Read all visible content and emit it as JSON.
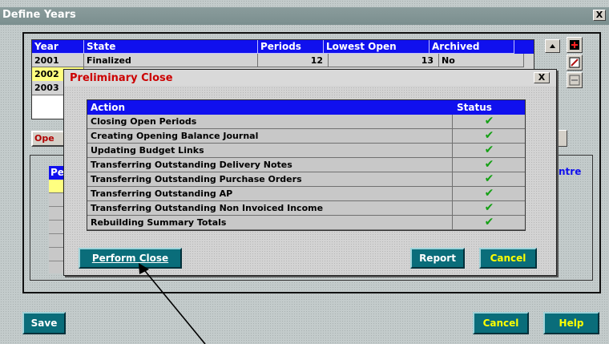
{
  "window": {
    "title": "Define Years",
    "close_glyph": "X"
  },
  "years_table": {
    "columns": [
      "Year",
      "State",
      "Periods",
      "Lowest Open",
      "Archived"
    ],
    "rows": [
      {
        "year": "2001",
        "state": "Finalized",
        "periods": "12",
        "lowest_open": "13",
        "archived": "No"
      },
      {
        "year": "2002"
      },
      {
        "year": "2003"
      }
    ]
  },
  "partial": {
    "open_button": "Ope",
    "period_header": "Pe",
    "centre_label": "ntre"
  },
  "dialog": {
    "title": "Preliminary Close",
    "close_glyph": "X",
    "columns": {
      "action": "Action",
      "status": "Status"
    },
    "rows": [
      {
        "action": "Closing Open Periods",
        "status": "done"
      },
      {
        "action": "Creating Opening Balance Journal",
        "status": "done"
      },
      {
        "action": "Updating Budget Links",
        "status": "done"
      },
      {
        "action": "Transferring Outstanding Delivery Notes",
        "status": "done"
      },
      {
        "action": "Transferring Outstanding Purchase Orders",
        "status": "done"
      },
      {
        "action": "Transferring Outstanding AP",
        "status": "done"
      },
      {
        "action": "Transferring Outstanding Non Invoiced Income",
        "status": "done"
      },
      {
        "action": "Rebuilding Summary Totals",
        "status": "done"
      }
    ],
    "buttons": {
      "perform_close": "Perform Close",
      "report": "Report",
      "cancel": "Cancel"
    }
  },
  "footer": {
    "save": "Save",
    "cancel": "Cancel",
    "help": "Help"
  },
  "icons": {
    "add": "plus-icon",
    "edit": "pencil-icon",
    "remove": "minus-icon",
    "status_done": "checkmark-icon",
    "scroll_up": "scroll-up-arrow-icon",
    "pointer": "arrow-annotation-icon"
  },
  "colors": {
    "header_blue": "#1010ee",
    "selected_row": "#ffff80",
    "button_teal": "#0a6d7a",
    "title_red": "#cc0000",
    "check_green": "#14a014"
  }
}
